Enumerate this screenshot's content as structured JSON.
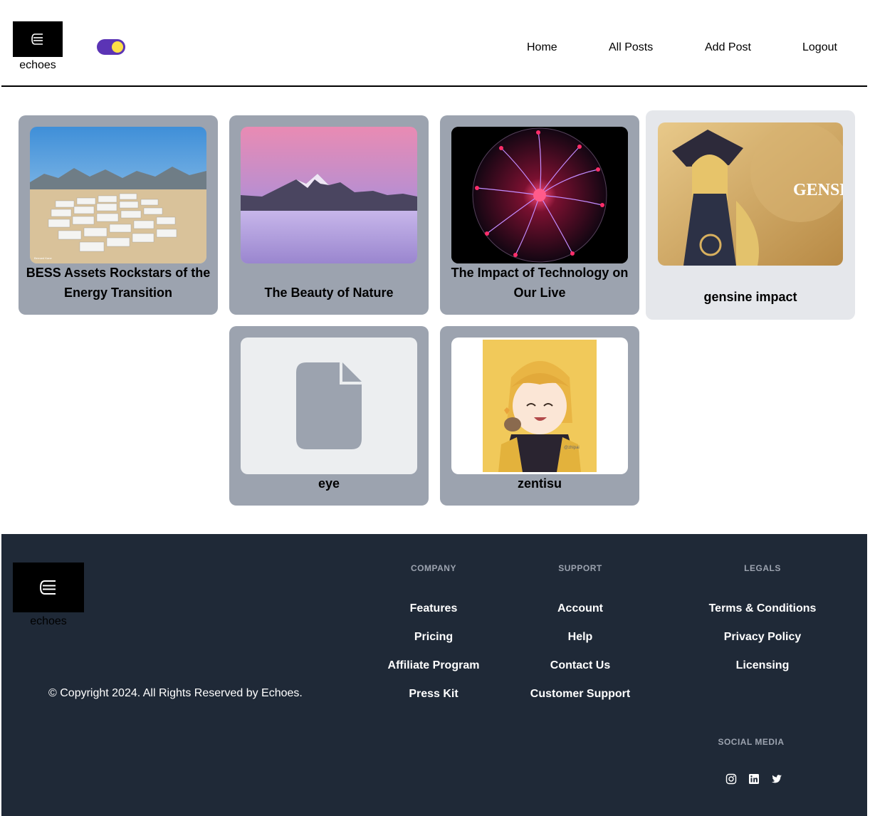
{
  "header": {
    "logo_text": "echoes",
    "theme_toggle": "on",
    "nav": [
      "Home",
      "All Posts",
      "Add Post",
      "Logout"
    ]
  },
  "posts": [
    {
      "title": "BESS Assets Rockstars of the Energy Transition",
      "image": "battery-storage-site-photo",
      "image_caption": "Bernard Kane"
    },
    {
      "title": "The Beauty of Nature",
      "image": "mountain-sunset-photo"
    },
    {
      "title": "The Impact of Technology on Our Live",
      "image": "plasma-ball-photo"
    },
    {
      "title": "gensine impact",
      "image": "genshin-impact-artwork",
      "image_text": "GENSHIN IMPACT"
    },
    {
      "title": "eye",
      "image": "file-placeholder-icon"
    },
    {
      "title": "zentisu",
      "image": "anime-character-drawing",
      "image_caption": "@zhipai"
    }
  ],
  "footer": {
    "logo_text": "echoes",
    "copyright": "© Copyright 2024. All Rights Reserved by Echoes.",
    "company": {
      "heading": "COMPANY",
      "links": [
        "Features",
        "Pricing",
        "Affiliate Program",
        "Press Kit"
      ]
    },
    "support": {
      "heading": "SUPPORT",
      "links": [
        "Account",
        "Help",
        "Contact Us",
        "Customer Support"
      ]
    },
    "legals": {
      "heading": "LEGALS",
      "links": [
        "Terms & Conditions",
        "Privacy Policy",
        "Licensing"
      ]
    },
    "social": {
      "heading": "SOCIAL MEDIA",
      "icons": [
        "instagram-icon",
        "linkedin-icon",
        "twitter-icon"
      ]
    }
  },
  "colors": {
    "card": "#9ca3af",
    "card_light": "#e5e7eb",
    "footer_bg": "#1f2937",
    "toggle": "#5b34b5",
    "toggle_knob": "#fde047"
  }
}
